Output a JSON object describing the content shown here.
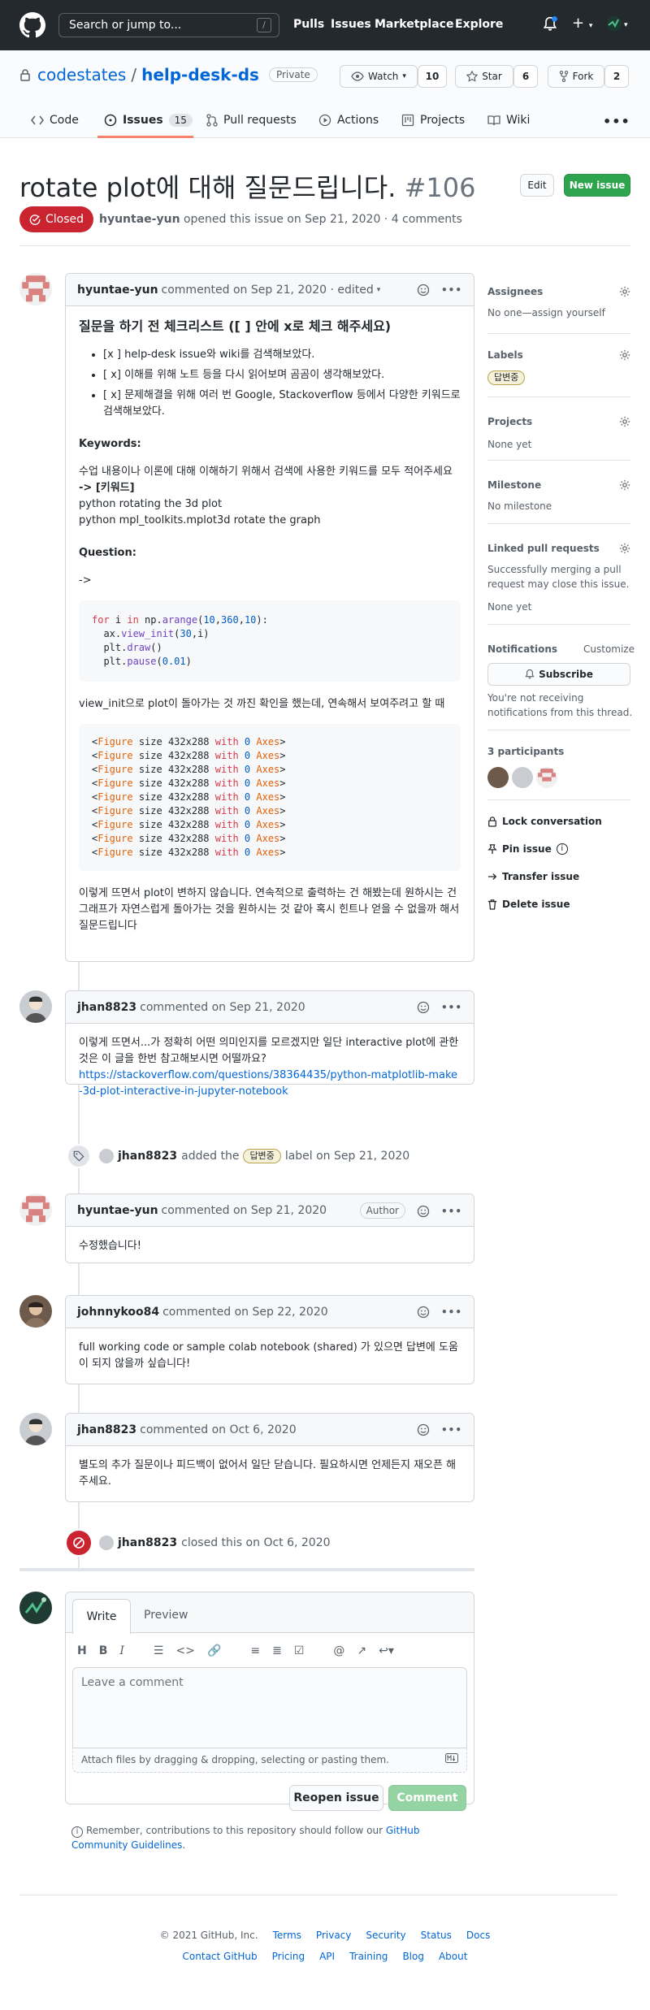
{
  "header": {
    "search_placeholder": "Search or jump to...",
    "slash": "/",
    "nav": [
      "Pulls",
      "Issues",
      "Marketplace",
      "Explore"
    ]
  },
  "repo": {
    "owner": "codestates",
    "separator": "/",
    "name": "help-desk-ds",
    "visibility": "Private",
    "watch_label": "Watch",
    "watch_count": "10",
    "star_label": "Star",
    "star_count": "6",
    "fork_label": "Fork",
    "fork_count": "2"
  },
  "tabs": [
    {
      "label": "Code"
    },
    {
      "label": "Issues",
      "count": "15"
    },
    {
      "label": "Pull requests"
    },
    {
      "label": "Actions"
    },
    {
      "label": "Projects"
    },
    {
      "label": "Wiki"
    }
  ],
  "issue": {
    "title": "rotate plot에 대해 질문드립니다.",
    "number": "#106",
    "edit_label": "Edit",
    "new_issue_label": "New issue",
    "state": "Closed",
    "author": "hyuntae-yun",
    "meta": "opened this issue on Sep 21, 2020 · 4 comments"
  },
  "first_comment": {
    "author": "hyuntae-yun",
    "meta": "commented on Sep 21, 2020 · edited",
    "heading": "질문을 하기 전 체크리스트 ([ ] 안에 x로 체크 해주세요)",
    "checklist": [
      "[x ] help-desk issue와 wiki를 검색해보았다.",
      "[ x] 이해를 위해 노트 등을 다시 읽어보며 곰곰이 생각해보았다.",
      "[ x] 문제해결을 위해 여러 번 Google, Stackoverflow 등에서 다양한 키워드로 검색해보았다."
    ],
    "keywords_title": "Keywords:",
    "keywords_desc": "수업 내용이나 이론에 대해 이해하기 위해서 검색에 사용한 키워드를 모두 적어주세요",
    "keywords_arrow": "-> [키워드]",
    "keywords": [
      "python rotating the 3d plot",
      "python mpl_toolkits.mplot3d rotate the graph"
    ],
    "question_title": "Question:",
    "question_arrow": "->",
    "code_lines": [
      [
        {
          "t": "for",
          "c": "kw"
        },
        {
          "t": " i "
        },
        {
          "t": "in",
          "c": "kw"
        },
        {
          "t": " np."
        },
        {
          "t": "arange",
          "c": "fn"
        },
        {
          "t": "("
        },
        {
          "t": "10",
          "c": "nm"
        },
        {
          "t": ","
        },
        {
          "t": "360",
          "c": "nm"
        },
        {
          "t": ","
        },
        {
          "t": "10",
          "c": "nm"
        },
        {
          "t": "):"
        }
      ],
      [
        {
          "t": "  ax."
        },
        {
          "t": "view_init",
          "c": "fn"
        },
        {
          "t": "("
        },
        {
          "t": "30",
          "c": "nm"
        },
        {
          "t": ",i)"
        }
      ],
      [
        {
          "t": "  plt."
        },
        {
          "t": "draw",
          "c": "fn"
        },
        {
          "t": "()"
        }
      ],
      [
        {
          "t": "  plt."
        },
        {
          "t": "pause",
          "c": "fn"
        },
        {
          "t": "("
        },
        {
          "t": "0.01",
          "c": "nm"
        },
        {
          "t": ")"
        }
      ]
    ],
    "middle_text": "view_init으로 plot이 돌아가는 것 까진 확인을 했는데, 연속해서 보여주려고 할 때",
    "figure_line": "<Figure size 432x288 with 0 Axes>",
    "figure_count": 9,
    "closing_text": "이렇게 뜨면서 plot이 변하지 않습니다. 연속적으로 출력하는 건 해봤는데 원하시는 건 그래프가 자연스럽게 돌아가는 것을 원하시는 것 같아 혹시 힌트나 얻을 수 없을까 해서 질문드립니다"
  },
  "comment2": {
    "author": "jhan8823",
    "meta": "commented on Sep 21, 2020",
    "body": "이렇게 뜨면서...가 정확히 어떤 의미인지를 모르겠지만 일단 interactive plot에 관한 것은 이 글을 한번 참고해보시면 어떨까요?",
    "link": "https://stackoverflow.com/questions/38364435/python-matplotlib-make-3d-plot-interactive-in-jupyter-notebook"
  },
  "label_event": {
    "actor": "jhan8823",
    "prefix": "added the",
    "label": "답변중",
    "suffix": "label on Sep 21, 2020"
  },
  "comment3": {
    "author": "hyuntae-yun",
    "meta": "commented on Sep 21, 2020",
    "badge": "Author",
    "body": "수정했습니다!"
  },
  "comment4": {
    "author": "johnnykoo84",
    "meta": "commented on Sep 22, 2020",
    "body": "full working code or sample colab notebook (shared) 가 있으면 답변에 도움이 되지 않을까 싶습니다!"
  },
  "comment5": {
    "author": "jhan8823",
    "meta": "commented on Oct 6, 2020",
    "body": "별도의 추가 질문이나 피드백이 없어서 일단 닫습니다. 필요하시면 언제든지 재오픈 해주세요."
  },
  "close_event": {
    "actor": "jhan8823",
    "text": "closed this on Oct 6, 2020"
  },
  "editor": {
    "write_tab": "Write",
    "preview_tab": "Preview",
    "placeholder": "Leave a comment",
    "attach_text": "Attach files by dragging & dropping, selecting or pasting them.",
    "reopen_label": "Reopen issue",
    "comment_label": "Comment",
    "remember_prefix": "Remember, contributions to this repository should follow our",
    "remember_link": "GitHub Community Guidelines",
    "remember_suffix": "."
  },
  "sidebar": {
    "assignees_title": "Assignees",
    "assignees_text": "No one—assign yourself",
    "labels_title": "Labels",
    "label": "답변중",
    "projects_title": "Projects",
    "projects_text": "None yet",
    "milestone_title": "Milestone",
    "milestone_text": "No milestone",
    "linked_title": "Linked pull requests",
    "linked_desc": "Successfully merging a pull request may close this issue.",
    "linked_text": "None yet",
    "notifications_title": "Notifications",
    "customize": "Customize",
    "subscribe_label": "Subscribe",
    "notif_text": "You're not receiving notifications from this thread.",
    "participants_title": "3 participants",
    "actions": [
      "Lock conversation",
      "Pin issue",
      "Transfer issue",
      "Delete issue"
    ]
  },
  "footer": {
    "copyright": "© 2021 GitHub, Inc.",
    "row1": [
      "Terms",
      "Privacy",
      "Security",
      "Status",
      "Docs"
    ],
    "row2": [
      "Contact GitHub",
      "Pricing",
      "API",
      "Training",
      "Blog",
      "About"
    ]
  }
}
